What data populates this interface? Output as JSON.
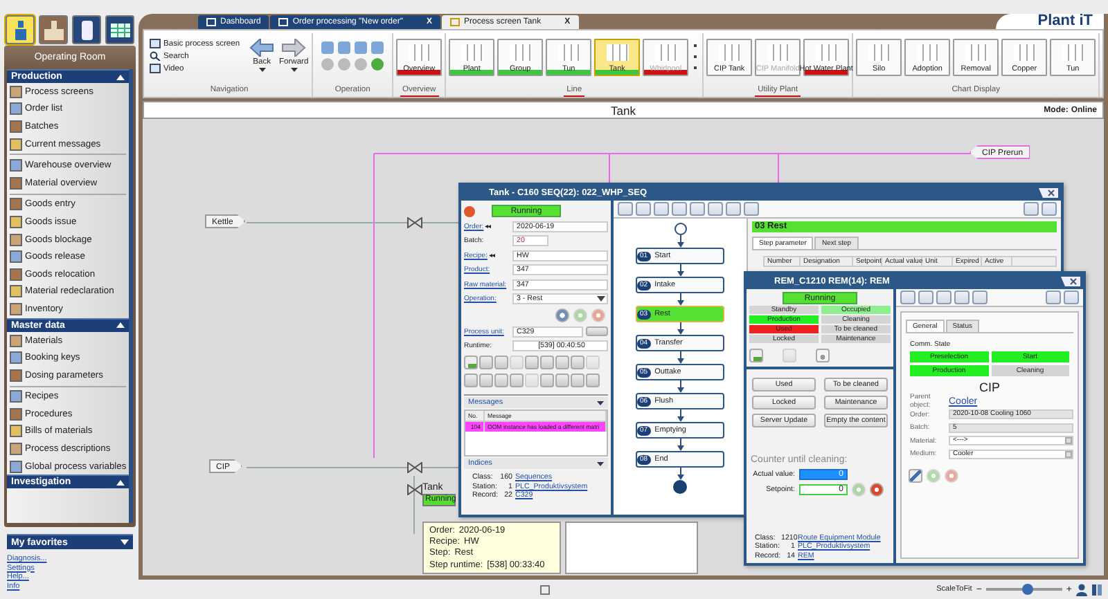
{
  "sidebar": {
    "mode_tabs": [
      {
        "selected": true
      },
      {
        "selected": false
      },
      {
        "selected": false
      },
      {
        "selected": false
      }
    ],
    "title": "Operating Room",
    "sections": [
      {
        "title": "Production",
        "expanded": true,
        "groups": [
          [
            "Process screens",
            "Order list",
            "Batches",
            "Current messages"
          ],
          [
            "Warehouse overview",
            "Material overview"
          ],
          [
            "Goods entry",
            "Goods issue",
            "Goods blockage",
            "Goods release",
            "Goods relocation",
            "Material redeclaration",
            "Inventory"
          ]
        ]
      },
      {
        "title": "Master data",
        "expanded": true,
        "groups": [
          [
            "Materials",
            "Booking keys",
            "Dosing parameters"
          ],
          [
            "Recipes",
            "Procedures",
            "Bills of materials",
            "Process descriptions",
            "Global process variables"
          ]
        ]
      },
      {
        "title": "Investigation",
        "expanded": true
      }
    ],
    "favorites": {
      "title": "My favorites",
      "expanded": false
    },
    "links": [
      "Diagnosis...",
      "Settings",
      "Help...",
      "Info"
    ]
  },
  "tabs": [
    {
      "label": "Dashboard",
      "selected": false
    },
    {
      "label": "Order processing \"New order\"",
      "selected": false,
      "close": "X"
    },
    {
      "label": "Process screen Tank",
      "selected": true,
      "close": "X"
    }
  ],
  "logo": "Plant iT",
  "ribbon": {
    "groups": [
      {
        "kind": "navigation",
        "label": "Navigation",
        "alarm": false,
        "links": [
          "Basic process screen",
          "Search",
          "Video"
        ],
        "buttons": [
          "Back",
          "Forward"
        ]
      },
      {
        "kind": "operation",
        "label": "Operation",
        "alarm": false
      },
      {
        "kind": "tiles",
        "label": "Overview",
        "alarm": true,
        "tiles": [
          {
            "label": "Overview",
            "selected": false,
            "disabled": false,
            "color": "#d01010"
          }
        ]
      },
      {
        "kind": "tiles",
        "label": "Line",
        "alarm": true,
        "tiles": [
          {
            "label": "Plant",
            "selected": false,
            "disabled": false,
            "color": "#3cc83c"
          },
          {
            "label": "Group",
            "selected": false,
            "disabled": false,
            "color": "#3cc83c"
          },
          {
            "label": "Tun",
            "selected": false,
            "disabled": false,
            "color": "#3cc83c"
          },
          {
            "label": "Tank",
            "selected": true,
            "disabled": false,
            "color": "#3cc83c"
          },
          {
            "label": "Whirlpool",
            "selected": false,
            "disabled": true,
            "color": "#d01010"
          }
        ]
      },
      {
        "kind": "tiles",
        "label": "Utility Plant",
        "alarm": true,
        "tiles": [
          {
            "label": "CIP Tank",
            "selected": false,
            "disabled": false
          },
          {
            "label": "CIP Manifold",
            "selected": false,
            "disabled": true
          },
          {
            "label": "Hot Water Plant",
            "selected": false,
            "disabled": false,
            "color": "#d01010"
          }
        ]
      },
      {
        "kind": "tiles",
        "label": "Chart Display",
        "alarm": false,
        "tiles": [
          {
            "label": "Silo",
            "selected": false,
            "disabled": false
          },
          {
            "label": "Adoption",
            "selected": false,
            "disabled": false
          },
          {
            "label": "Removal",
            "selected": false,
            "disabled": false
          },
          {
            "label": "Copper",
            "selected": false,
            "disabled": false
          },
          {
            "label": "Tun",
            "selected": false,
            "disabled": false
          }
        ]
      }
    ]
  },
  "screen": {
    "title": "Tank",
    "mode_label": "Mode:",
    "mode": "Online"
  },
  "canvas": {
    "tags": [
      {
        "text": "CIP Prerun",
        "kind": "left"
      },
      {
        "text": "Kettle",
        "kind": "right"
      },
      {
        "text": "CIP",
        "kind": "right"
      }
    ],
    "tank_panel": {
      "title": "Tank",
      "status": "Running",
      "lines": [
        [
          "Order:",
          "2020-06-19"
        ],
        [
          "Recipe:",
          "HW"
        ],
        [
          "Step:",
          "Rest"
        ],
        [
          "Step runtime:",
          "[538] 00:33:40"
        ]
      ]
    }
  },
  "sequence_window": {
    "title": "Tank - C160 SEQ(22): 022_WHP_SEQ",
    "status": "Running",
    "fields": [
      {
        "label": "Order:",
        "link": true,
        "arrows": "◂◂",
        "value": "2020-06-19",
        "kind": "text"
      },
      {
        "label": "Batch:",
        "link": false,
        "value": "20",
        "kind": "short"
      },
      {
        "label": "Recipe:",
        "link": true,
        "arrows": "◂◂",
        "value": "HW",
        "kind": "text"
      },
      {
        "label": "Product:",
        "link": true,
        "value": "347",
        "kind": "text"
      },
      {
        "label": "Raw material:",
        "link": true,
        "value": "347",
        "kind": "text"
      },
      {
        "label": "Operation:",
        "link": true,
        "value": "3 - Rest",
        "kind": "select"
      }
    ],
    "process_unit": {
      "label": "Process unit:",
      "value": "C329"
    },
    "runtime": {
      "label": "Runtime:",
      "value": "[539] 00:40:50"
    },
    "messages": {
      "title": "Messages",
      "columns": [
        "No.",
        "Message"
      ],
      "rows": [
        {
          "no": "104",
          "message": "OOM instance has loaded a different matri",
          "color": "#ff44ff"
        }
      ]
    },
    "indices": {
      "title": "Indices",
      "rows": [
        {
          "label": "Class:",
          "number": "160",
          "link": "Sequences"
        },
        {
          "label": "Station:",
          "number": "1",
          "link": "PLC_Produktivsystem"
        },
        {
          "label": "Record:",
          "number": "22",
          "link": "C329"
        }
      ]
    },
    "steps": [
      {
        "number": "01",
        "label": "Start",
        "active": false
      },
      {
        "number": "02",
        "label": "Intake",
        "active": false
      },
      {
        "number": "03",
        "label": "Rest",
        "active": true
      },
      {
        "number": "04",
        "label": "Transfer",
        "active": false
      },
      {
        "number": "05",
        "label": "Outtake",
        "active": false
      },
      {
        "number": "06",
        "label": "Flush",
        "active": false
      },
      {
        "number": "07",
        "label": "Emptying",
        "active": false
      },
      {
        "number": "08",
        "label": "End",
        "active": false
      }
    ],
    "step_header": "03 Rest",
    "step_tabs": [
      {
        "label": "Step parameter",
        "selected": true
      },
      {
        "label": "Next step",
        "selected": false
      }
    ],
    "step_columns": [
      "Number",
      "Designation",
      "Setpoint",
      "Actual value",
      "Unit",
      "Expired",
      "Active"
    ]
  },
  "rem_window": {
    "title": "REM_C1210 REM(14): REM",
    "status": "Running",
    "states": [
      {
        "label": "Standby",
        "color": "#d4d4d4"
      },
      {
        "label": "Occupied",
        "color": "#90ee90"
      },
      {
        "label": "Production",
        "color": "#22ee22"
      },
      {
        "label": "Cleaning",
        "color": "#d4d4d4"
      },
      {
        "label": "Used",
        "color": "#ee2222"
      },
      {
        "label": "To be cleaned",
        "color": "#d4d4d4"
      },
      {
        "label": "Locked",
        "color": "#d4d4d4"
      },
      {
        "label": "Maintenance",
        "color": "#d4d4d4"
      }
    ],
    "buttons": [
      "Used",
      "To be cleaned",
      "Locked",
      "Maintenance",
      "Server Update",
      "Empty the content"
    ],
    "counter": {
      "title": "Counter until cleaning:",
      "actual_label": "Actual value:",
      "actual": "0",
      "setpoint_label": "Setpoint:",
      "setpoint": "0"
    },
    "indices": [
      {
        "label": "Class:",
        "number": "1210",
        "link": "Route Equipment Module"
      },
      {
        "label": "Station:",
        "number": "1",
        "link": "PLC_Produktivsystem"
      },
      {
        "label": "Record:",
        "number": "14",
        "link": "REM"
      }
    ],
    "tabs": [
      {
        "label": "General",
        "selected": true
      },
      {
        "label": "Status",
        "selected": false
      }
    ],
    "comm_label": "Comm. State",
    "comm_states": [
      {
        "label": "Preselection",
        "color": "#22ee22"
      },
      {
        "label": "Start",
        "color": "#22ee22"
      },
      {
        "label": "Production",
        "color": "#22ee22"
      },
      {
        "label": "Cleaning",
        "color": "#d4d4d4"
      }
    ],
    "heading": "CIP",
    "parent_label": "Parent object:",
    "parent": "Cooler",
    "props": [
      {
        "label": "Order:",
        "value": "2020-10-08 Cooling 1060",
        "kind": "text"
      },
      {
        "label": "Batch:",
        "value": "5",
        "kind": "text"
      },
      {
        "label": "Material:",
        "value": "<--->",
        "kind": "select"
      },
      {
        "label": "Medium:",
        "value": "Cooler",
        "kind": "select"
      }
    ]
  },
  "status_bar": {
    "zoom_label": "ScaleToFit",
    "minus": "−",
    "plus": "+",
    "zoom": {
      "level": 0.55
    }
  }
}
